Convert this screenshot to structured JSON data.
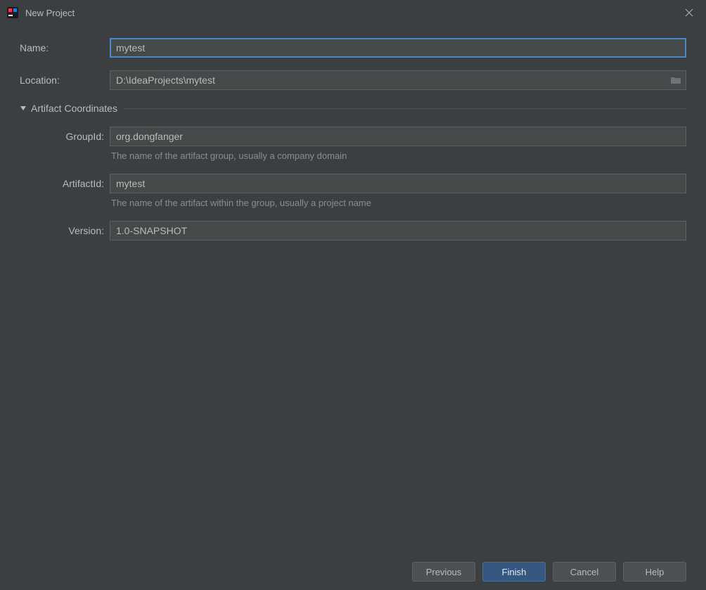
{
  "window": {
    "title": "New Project"
  },
  "form": {
    "name_label": "Name:",
    "name_value": "mytest",
    "location_label": "Location:",
    "location_value": "D:\\IdeaProjects\\mytest"
  },
  "artifact": {
    "section_label": "Artifact Coordinates",
    "groupid_label": "GroupId:",
    "groupid_value": "org.dongfanger",
    "groupid_hint": "The name of the artifact group, usually a company domain",
    "artifactid_label": "ArtifactId:",
    "artifactid_value": "mytest",
    "artifactid_hint": "The name of the artifact within the group, usually a project name",
    "version_label": "Version:",
    "version_value": "1.0-SNAPSHOT"
  },
  "buttons": {
    "previous": "Previous",
    "finish": "Finish",
    "cancel": "Cancel",
    "help": "Help"
  }
}
